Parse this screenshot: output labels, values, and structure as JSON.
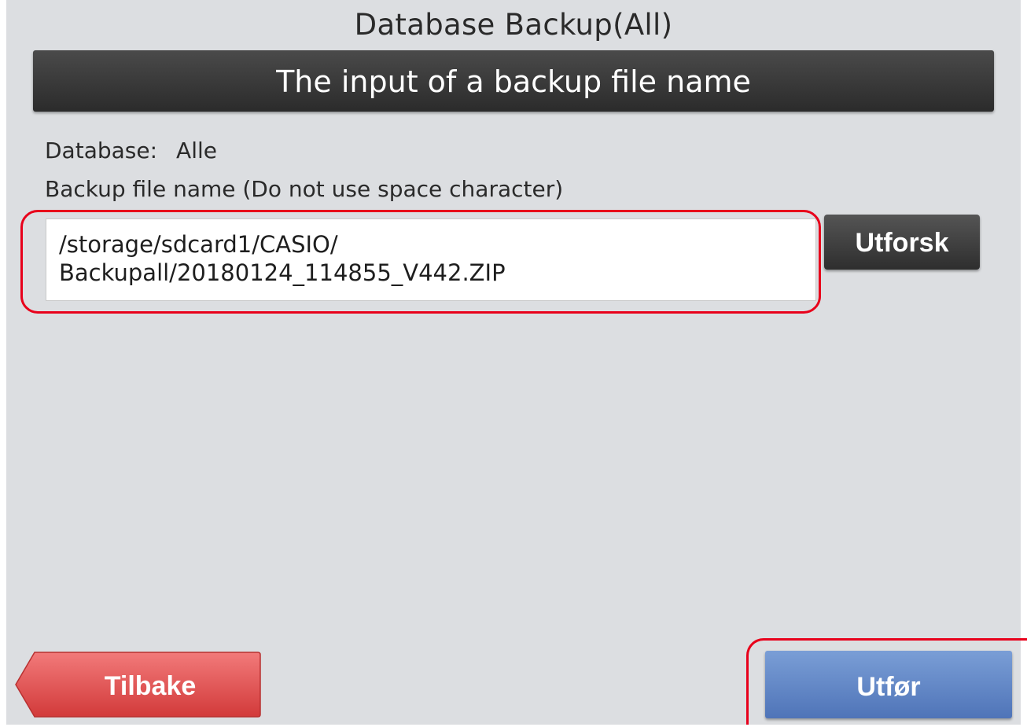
{
  "window": {
    "title": "Database Backup(All)"
  },
  "header": {
    "title": "The input of a backup file name"
  },
  "database": {
    "label": "Database:",
    "value": "Alle"
  },
  "hint": {
    "text": "Backup file name (Do not use space character)"
  },
  "file_input": {
    "value": "/storage/sdcard1/CASIO/\nBackupall/20180124_114855_V442.ZIP"
  },
  "buttons": {
    "browse": "Utforsk",
    "back": "Tilbake",
    "execute": "Utfør"
  },
  "colors": {
    "highlight": "#e8001b",
    "back_button": "#e55a5a",
    "execute_button": "#6a8fcb",
    "header": "#333333"
  }
}
